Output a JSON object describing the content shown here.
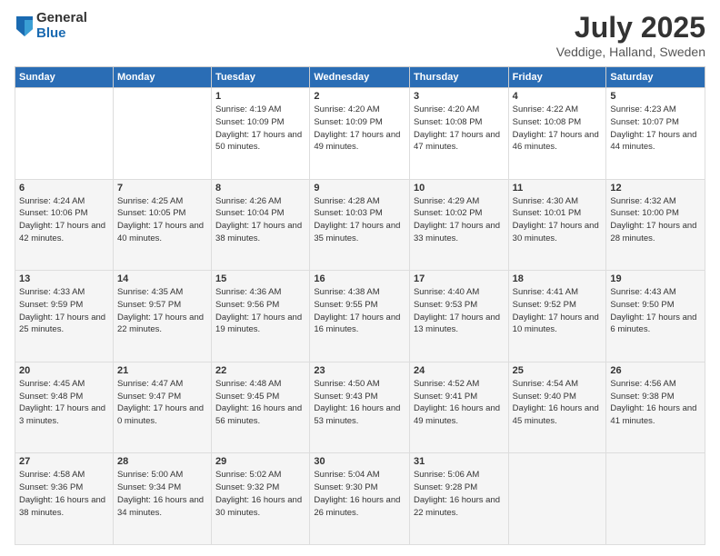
{
  "header": {
    "logo_general": "General",
    "logo_blue": "Blue",
    "month_title": "July 2025",
    "subtitle": "Veddige, Halland, Sweden"
  },
  "calendar": {
    "headers": [
      "Sunday",
      "Monday",
      "Tuesday",
      "Wednesday",
      "Thursday",
      "Friday",
      "Saturday"
    ],
    "rows": [
      [
        {
          "day": "",
          "info": ""
        },
        {
          "day": "",
          "info": ""
        },
        {
          "day": "1",
          "info": "Sunrise: 4:19 AM\nSunset: 10:09 PM\nDaylight: 17 hours\nand 50 minutes."
        },
        {
          "day": "2",
          "info": "Sunrise: 4:20 AM\nSunset: 10:09 PM\nDaylight: 17 hours\nand 49 minutes."
        },
        {
          "day": "3",
          "info": "Sunrise: 4:20 AM\nSunset: 10:08 PM\nDaylight: 17 hours\nand 47 minutes."
        },
        {
          "day": "4",
          "info": "Sunrise: 4:22 AM\nSunset: 10:08 PM\nDaylight: 17 hours\nand 46 minutes."
        },
        {
          "day": "5",
          "info": "Sunrise: 4:23 AM\nSunset: 10:07 PM\nDaylight: 17 hours\nand 44 minutes."
        }
      ],
      [
        {
          "day": "6",
          "info": "Sunrise: 4:24 AM\nSunset: 10:06 PM\nDaylight: 17 hours\nand 42 minutes."
        },
        {
          "day": "7",
          "info": "Sunrise: 4:25 AM\nSunset: 10:05 PM\nDaylight: 17 hours\nand 40 minutes."
        },
        {
          "day": "8",
          "info": "Sunrise: 4:26 AM\nSunset: 10:04 PM\nDaylight: 17 hours\nand 38 minutes."
        },
        {
          "day": "9",
          "info": "Sunrise: 4:28 AM\nSunset: 10:03 PM\nDaylight: 17 hours\nand 35 minutes."
        },
        {
          "day": "10",
          "info": "Sunrise: 4:29 AM\nSunset: 10:02 PM\nDaylight: 17 hours\nand 33 minutes."
        },
        {
          "day": "11",
          "info": "Sunrise: 4:30 AM\nSunset: 10:01 PM\nDaylight: 17 hours\nand 30 minutes."
        },
        {
          "day": "12",
          "info": "Sunrise: 4:32 AM\nSunset: 10:00 PM\nDaylight: 17 hours\nand 28 minutes."
        }
      ],
      [
        {
          "day": "13",
          "info": "Sunrise: 4:33 AM\nSunset: 9:59 PM\nDaylight: 17 hours\nand 25 minutes."
        },
        {
          "day": "14",
          "info": "Sunrise: 4:35 AM\nSunset: 9:57 PM\nDaylight: 17 hours\nand 22 minutes."
        },
        {
          "day": "15",
          "info": "Sunrise: 4:36 AM\nSunset: 9:56 PM\nDaylight: 17 hours\nand 19 minutes."
        },
        {
          "day": "16",
          "info": "Sunrise: 4:38 AM\nSunset: 9:55 PM\nDaylight: 17 hours\nand 16 minutes."
        },
        {
          "day": "17",
          "info": "Sunrise: 4:40 AM\nSunset: 9:53 PM\nDaylight: 17 hours\nand 13 minutes."
        },
        {
          "day": "18",
          "info": "Sunrise: 4:41 AM\nSunset: 9:52 PM\nDaylight: 17 hours\nand 10 minutes."
        },
        {
          "day": "19",
          "info": "Sunrise: 4:43 AM\nSunset: 9:50 PM\nDaylight: 17 hours\nand 6 minutes."
        }
      ],
      [
        {
          "day": "20",
          "info": "Sunrise: 4:45 AM\nSunset: 9:48 PM\nDaylight: 17 hours\nand 3 minutes."
        },
        {
          "day": "21",
          "info": "Sunrise: 4:47 AM\nSunset: 9:47 PM\nDaylight: 17 hours\nand 0 minutes."
        },
        {
          "day": "22",
          "info": "Sunrise: 4:48 AM\nSunset: 9:45 PM\nDaylight: 16 hours\nand 56 minutes."
        },
        {
          "day": "23",
          "info": "Sunrise: 4:50 AM\nSunset: 9:43 PM\nDaylight: 16 hours\nand 53 minutes."
        },
        {
          "day": "24",
          "info": "Sunrise: 4:52 AM\nSunset: 9:41 PM\nDaylight: 16 hours\nand 49 minutes."
        },
        {
          "day": "25",
          "info": "Sunrise: 4:54 AM\nSunset: 9:40 PM\nDaylight: 16 hours\nand 45 minutes."
        },
        {
          "day": "26",
          "info": "Sunrise: 4:56 AM\nSunset: 9:38 PM\nDaylight: 16 hours\nand 41 minutes."
        }
      ],
      [
        {
          "day": "27",
          "info": "Sunrise: 4:58 AM\nSunset: 9:36 PM\nDaylight: 16 hours\nand 38 minutes."
        },
        {
          "day": "28",
          "info": "Sunrise: 5:00 AM\nSunset: 9:34 PM\nDaylight: 16 hours\nand 34 minutes."
        },
        {
          "day": "29",
          "info": "Sunrise: 5:02 AM\nSunset: 9:32 PM\nDaylight: 16 hours\nand 30 minutes."
        },
        {
          "day": "30",
          "info": "Sunrise: 5:04 AM\nSunset: 9:30 PM\nDaylight: 16 hours\nand 26 minutes."
        },
        {
          "day": "31",
          "info": "Sunrise: 5:06 AM\nSunset: 9:28 PM\nDaylight: 16 hours\nand 22 minutes."
        },
        {
          "day": "",
          "info": ""
        },
        {
          "day": "",
          "info": ""
        }
      ]
    ]
  }
}
